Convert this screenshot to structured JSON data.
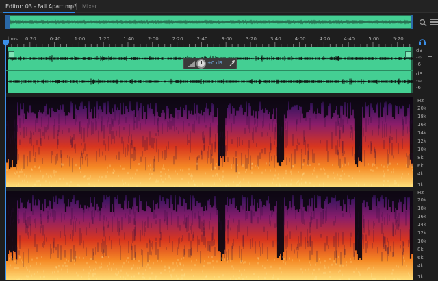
{
  "tabs": {
    "editor_label": "Editor: 03 - Fall Apart.mp3",
    "menu_glyph": "≡",
    "mixer_label": "Mixer"
  },
  "ruler": {
    "unit_label": "hms",
    "ticks": [
      "0:20",
      "0:40",
      "1:00",
      "1:20",
      "1:40",
      "2:00",
      "2:20",
      "2:40",
      "3:00",
      "3:20",
      "3:40",
      "4:00",
      "4:20",
      "4:40",
      "5:00",
      "5:20"
    ]
  },
  "hud": {
    "volume_value": "+0 dB"
  },
  "db_scale": {
    "channel1": [
      "dB",
      "-6",
      "-6"
    ],
    "channel2": [
      "dB",
      "-6",
      "-6"
    ],
    "inf_marks": [
      "-∞",
      "-∞"
    ]
  },
  "freq_scale": {
    "unit": "Hz",
    "labels": [
      "20k",
      "18k",
      "16k",
      "14k",
      "12k",
      "10k",
      "8k",
      "6k",
      "4k",
      "1k"
    ]
  },
  "icons": {
    "zoom": "zoom-magnifier-icon",
    "panel_menu": "hamburger-menu-icon",
    "pin": "pin-icon",
    "playhead": "playhead-marker-icon"
  },
  "colors": {
    "waveform_bg": "#44cf93",
    "waveform_fg": "#101010",
    "accent": "#2d8ceb",
    "spectro_low": "#ffd36a",
    "spectro_mid": "#e8431c",
    "spectro_high": "#5b1f7a",
    "spectro_none": "#120816"
  }
}
